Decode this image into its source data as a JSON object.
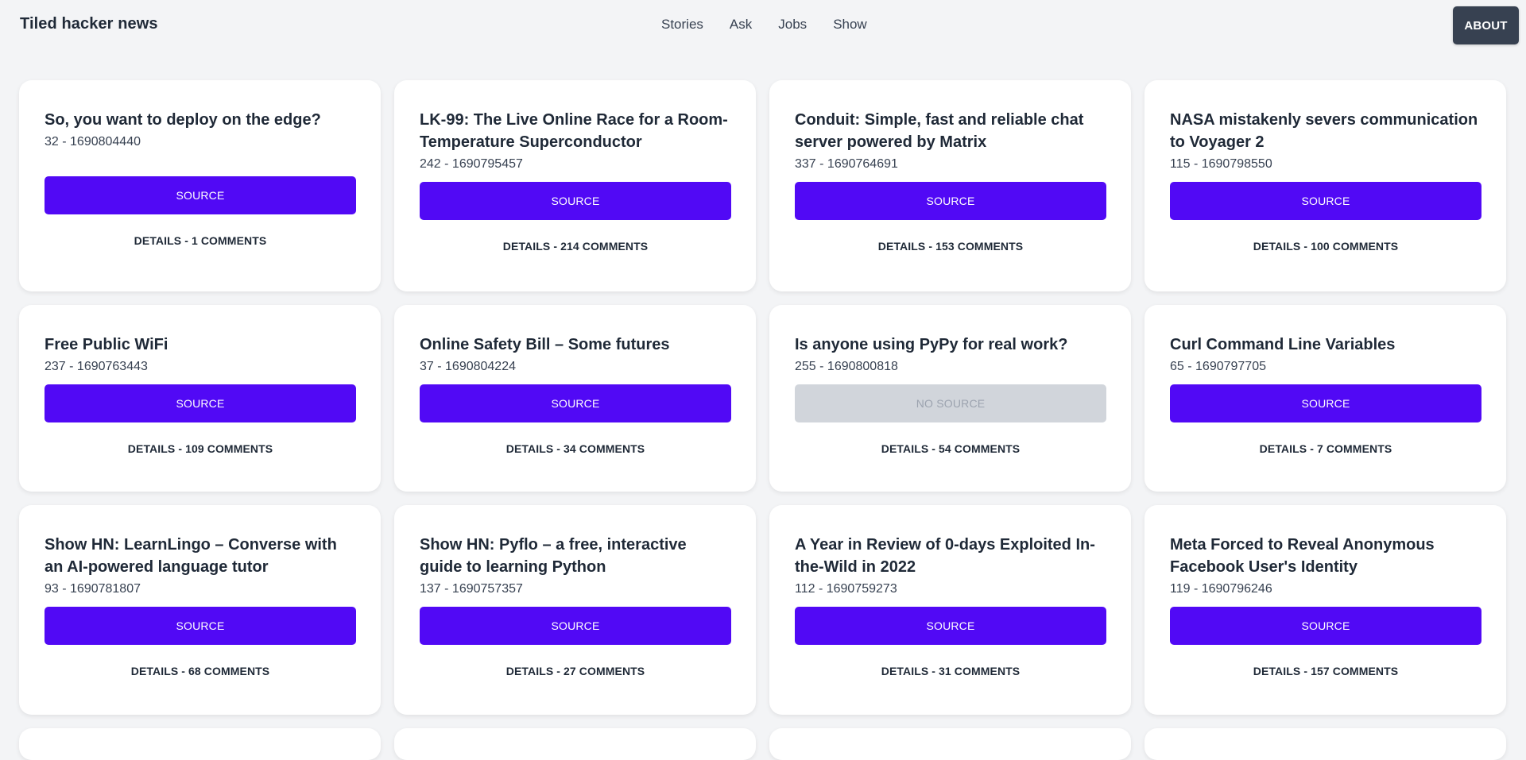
{
  "header": {
    "brand": "Tiled hacker news",
    "nav": [
      "Stories",
      "Ask",
      "Jobs",
      "Show"
    ],
    "about_label": "ABOUT"
  },
  "cards": [
    {
      "title": "So, you want to deploy on the edge?",
      "meta": "32 - 1690804440",
      "source_label": "SOURCE",
      "has_source": true,
      "details": "DETAILS - 1 COMMENTS"
    },
    {
      "title": "LK-99: The Live Online Race for a Room-Temperature Superconductor",
      "meta": "242 - 1690795457",
      "source_label": "SOURCE",
      "has_source": true,
      "details": "DETAILS - 214 COMMENTS"
    },
    {
      "title": "Conduit: Simple, fast and reliable chat server powered by Matrix",
      "meta": "337 - 1690764691",
      "source_label": "SOURCE",
      "has_source": true,
      "details": "DETAILS - 153 COMMENTS"
    },
    {
      "title": "NASA mistakenly severs communication to Voyager 2",
      "meta": "115 - 1690798550",
      "source_label": "SOURCE",
      "has_source": true,
      "details": "DETAILS - 100 COMMENTS"
    },
    {
      "title": "Free Public WiFi",
      "meta": "237 - 1690763443",
      "source_label": "SOURCE",
      "has_source": true,
      "details": "DETAILS - 109 COMMENTS"
    },
    {
      "title": "Online Safety Bill – Some futures",
      "meta": "37 - 1690804224",
      "source_label": "SOURCE",
      "has_source": true,
      "details": "DETAILS - 34 COMMENTS"
    },
    {
      "title": "Is anyone using PyPy for real work?",
      "meta": "255 - 1690800818",
      "source_label": "NO SOURCE",
      "has_source": false,
      "details": "DETAILS - 54 COMMENTS"
    },
    {
      "title": "Curl Command Line Variables",
      "meta": "65 - 1690797705",
      "source_label": "SOURCE",
      "has_source": true,
      "details": "DETAILS - 7 COMMENTS"
    },
    {
      "title": "Show HN: LearnLingo – Converse with an AI-powered language tutor",
      "meta": "93 - 1690781807",
      "source_label": "SOURCE",
      "has_source": true,
      "details": "DETAILS - 68 COMMENTS"
    },
    {
      "title": "Show HN: Pyflo – a free, interactive guide to learning Python",
      "meta": "137 - 1690757357",
      "source_label": "SOURCE",
      "has_source": true,
      "details": "DETAILS - 27 COMMENTS"
    },
    {
      "title": "A Year in Review of 0-days Exploited In-the-Wild in 2022",
      "meta": "112 - 1690759273",
      "source_label": "SOURCE",
      "has_source": true,
      "details": "DETAILS - 31 COMMENTS"
    },
    {
      "title": "Meta Forced to Reveal Anonymous Facebook User's Identity",
      "meta": "119 - 1690796246",
      "source_label": "SOURCE",
      "has_source": true,
      "details": "DETAILS - 157 COMMENTS"
    }
  ],
  "colors": {
    "source_button": "#5109f5",
    "no_source_button": "#d1d5db",
    "about_button": "#374151",
    "background": "#f3f4f6"
  }
}
